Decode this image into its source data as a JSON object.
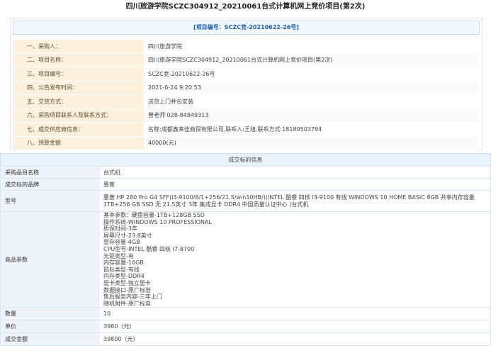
{
  "title": "四川旅游学院SCZC304912_20210061台式计算机网上竞价项目(第2次)",
  "project_no_banner": "[项目编号：SCZC竞-20210622-26号]",
  "info_rows": [
    {
      "label": "一、采购人：",
      "value": "四川旅游学院"
    },
    {
      "label": "二、项目名称：",
      "value": "四川旅游学院SCZC304912_20210061台式计算机网上竞价项目(第2次)"
    },
    {
      "label": "三、项目编号：",
      "value": "SCZC竞-20210622-26号"
    },
    {
      "label": "四、公告发布时间：",
      "value": "2021-6-24 9:20:53"
    },
    {
      "label": "五、交货方式：",
      "value": "送货上门并包安装"
    },
    {
      "label": "六、采购项目联系人及联系方式：",
      "value": "曾老师     028-84849313"
    },
    {
      "label": "七、成交供应商信息：",
      "value": "名称:成都鑫来佳商贸有限公司,联系人:王旭,联系方式:18180503784"
    },
    {
      "label": "八、预算金额",
      "value": "40000(元)"
    }
  ],
  "deal_section_title": "成交标的信息",
  "deal": {
    "item_name_label": "采购品目名称",
    "item_name_value": "台式机",
    "brand_label": "成交标的品牌",
    "brand_value": "惠普",
    "model_label": "型号",
    "model_value": "惠普 HP 280 Pro G4 SFF(i3-9100/8/1+256/21.5/win10HB/)(INTEL 酷睿 四核 I3-9100 有线 WINDOWS 10 HOME BASIC 8GB 共享内存容量 1TB+256 GB SSD 无 21.5英寸 3年 集成显卡 DDR4 中国质量认证中心 )台式机",
    "params_label": "商品参数",
    "params_lines": [
      "基本参数：硬盘容量-1TB+128GB SSD",
      "操作系统-WINDOWS 10 PROFESSIONAL",
      "质保时间-3年",
      "屏幕尺寸-23.8英寸",
      "显存容量-4GB",
      "CPU型号-INTEL 酷睿 四核 I7-8700",
      "光驱类型-有",
      "内存容量-16GB",
      "鼠标类型-有线",
      "内存类型-DDR4",
      "显卡类型-独立显卡",
      "数据接口-原厂标准",
      "售后服务内容-三年上门",
      "随机附件-原厂标准"
    ],
    "qty_label": "数量",
    "qty_value": "10",
    "unit_price_label": "单价",
    "unit_price_value": "3980（元）",
    "total_label": "成交金额",
    "total_value": "39800（元）"
  }
}
